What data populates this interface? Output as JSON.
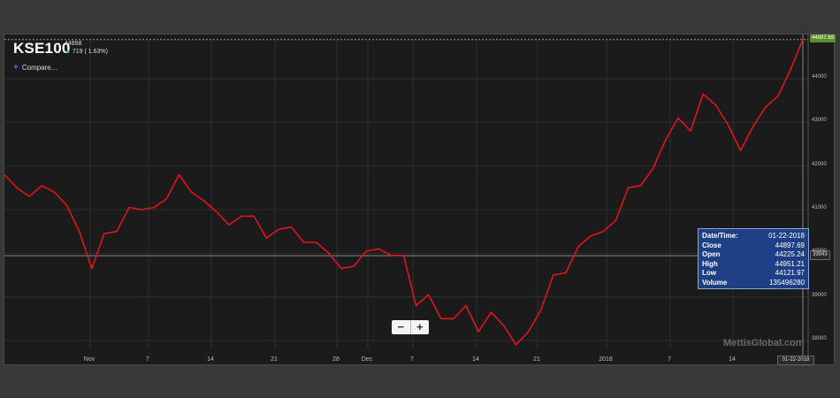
{
  "header": {
    "ticker": "KSE100",
    "last": "44898",
    "change": "719 ( 1.63%)",
    "compare_label": "Compare..."
  },
  "zoom": {
    "minus": "−",
    "plus": "+"
  },
  "tooltip": {
    "rows": [
      {
        "k": "Date/Time:",
        "v": "01-22-2018"
      },
      {
        "k": "Close",
        "v": "44897.69"
      },
      {
        "k": "Open",
        "v": "44225.24"
      },
      {
        "k": "High",
        "v": "44951.21"
      },
      {
        "k": "Low",
        "v": "44121.97"
      },
      {
        "k": "Volume",
        "v": "135496280"
      }
    ]
  },
  "badges": {
    "last_price": "44897.69",
    "crosshair_price": "39943",
    "crosshair_date": "01-22-2018"
  },
  "watermark": "MettisGlobal.com",
  "colors": {
    "line": "#e0141c",
    "background": "#1b1b1b",
    "grid": "#2f2f2f",
    "tooltip_bg": "#1e3f86"
  },
  "chart_data": {
    "type": "line",
    "series": [
      {
        "values": [
          41800,
          41500,
          41300,
          41550,
          41400,
          41100,
          40500,
          39650,
          40450,
          40500,
          41050,
          41000,
          41050,
          41250,
          41800,
          41400,
          41200,
          40950,
          40650,
          40850,
          40850,
          40350,
          40550,
          40600,
          40250,
          40250,
          40000,
          39650,
          39700,
          40050,
          40100,
          39950,
          39950,
          38800,
          39050,
          38500,
          38500,
          38800,
          38200,
          38650,
          38350,
          37900,
          38200,
          38700,
          39500,
          39550,
          40150,
          40400,
          40500,
          40750,
          41500,
          41550,
          41950,
          42600,
          43100,
          42800,
          43650,
          43400,
          42950,
          42350,
          42900,
          43350,
          43600,
          44200,
          44900
        ]
      }
    ],
    "y_ticks": [
      38000,
      39000,
      40000,
      41000,
      42000,
      43000,
      44000
    ],
    "x_ticks": [
      "Nov",
      "7",
      "14",
      "21",
      "28",
      "Dec",
      "7",
      "14",
      "21",
      "2018",
      "7",
      "14"
    ],
    "ylim": [
      37800,
      45000
    ]
  }
}
